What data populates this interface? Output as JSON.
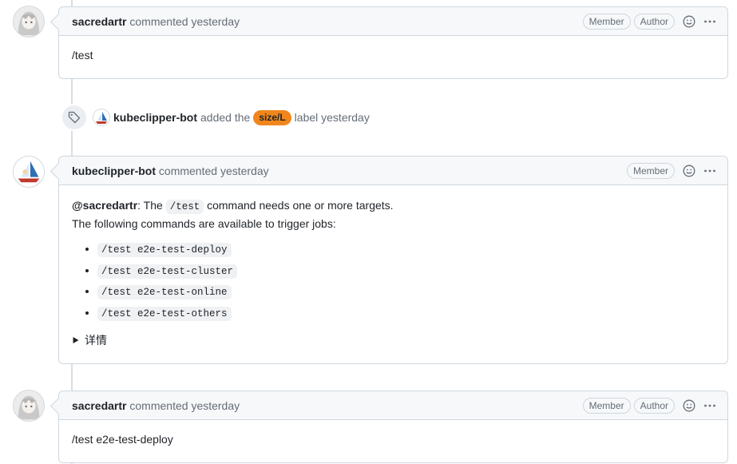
{
  "comments": [
    {
      "author": "sacredartr",
      "verb": "commented",
      "time": "yesterday",
      "badges": [
        "Member",
        "Author"
      ],
      "body": "/test"
    },
    {
      "author": "kubeclipper-bot",
      "verb": "commented",
      "time": "yesterday",
      "badges": [
        "Member"
      ],
      "mention": "@sacredartr",
      "line1_pre": ": The",
      "line1_code": "/test",
      "line1_post": "command needs one or more targets.",
      "line2": "The following commands are available to trigger jobs:",
      "commands": [
        "/test e2e-test-deploy",
        "/test e2e-test-cluster",
        "/test e2e-test-online",
        "/test e2e-test-others"
      ],
      "details_label": "详情"
    },
    {
      "author": "sacredartr",
      "verb": "commented",
      "time": "yesterday",
      "badges": [
        "Member",
        "Author"
      ],
      "body": "/test e2e-test-deploy"
    }
  ],
  "event": {
    "actor": "kubeclipper-bot",
    "action": "added the",
    "label": "size/L",
    "suffix": "label yesterday",
    "label_color": "#f0861c"
  },
  "icons": {
    "event": "tag-icon",
    "reaction": "smiley-icon",
    "menu": "kebab-icon",
    "details": "triangle-right-icon"
  }
}
